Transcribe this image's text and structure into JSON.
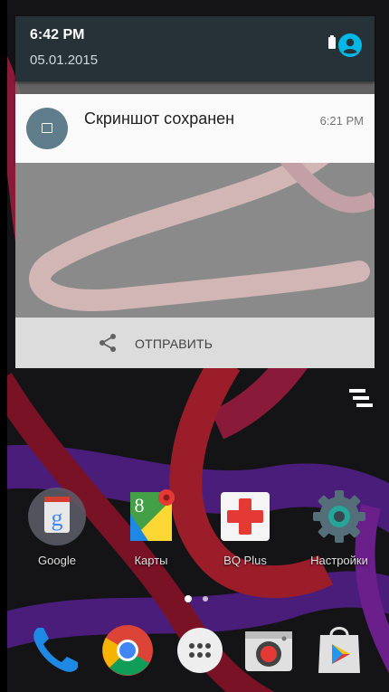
{
  "status_bar": {
    "time": "6:42 PM",
    "date": "05.01.2015"
  },
  "notification": {
    "title": "Скриншот сохранен",
    "time": "6:21 PM",
    "icon": "image-icon",
    "action": {
      "label": "ОТПРАВИТЬ",
      "icon": "share-icon"
    }
  },
  "home": {
    "apps": [
      {
        "label": "Google",
        "icon": "google-folder-icon"
      },
      {
        "label": "Карты",
        "icon": "maps-icon"
      },
      {
        "label": "BQ Plus",
        "icon": "bq-plus-icon"
      },
      {
        "label": "Настройки",
        "icon": "settings-icon"
      }
    ],
    "dock": [
      {
        "icon": "phone-icon"
      },
      {
        "icon": "chrome-icon"
      },
      {
        "icon": "app-drawer-icon"
      },
      {
        "icon": "camera-icon"
      },
      {
        "icon": "play-store-icon"
      }
    ]
  },
  "colors": {
    "status_bar": "#263238",
    "user_accent": "#00b8e6",
    "notif_icon_bg": "#607d8b"
  }
}
